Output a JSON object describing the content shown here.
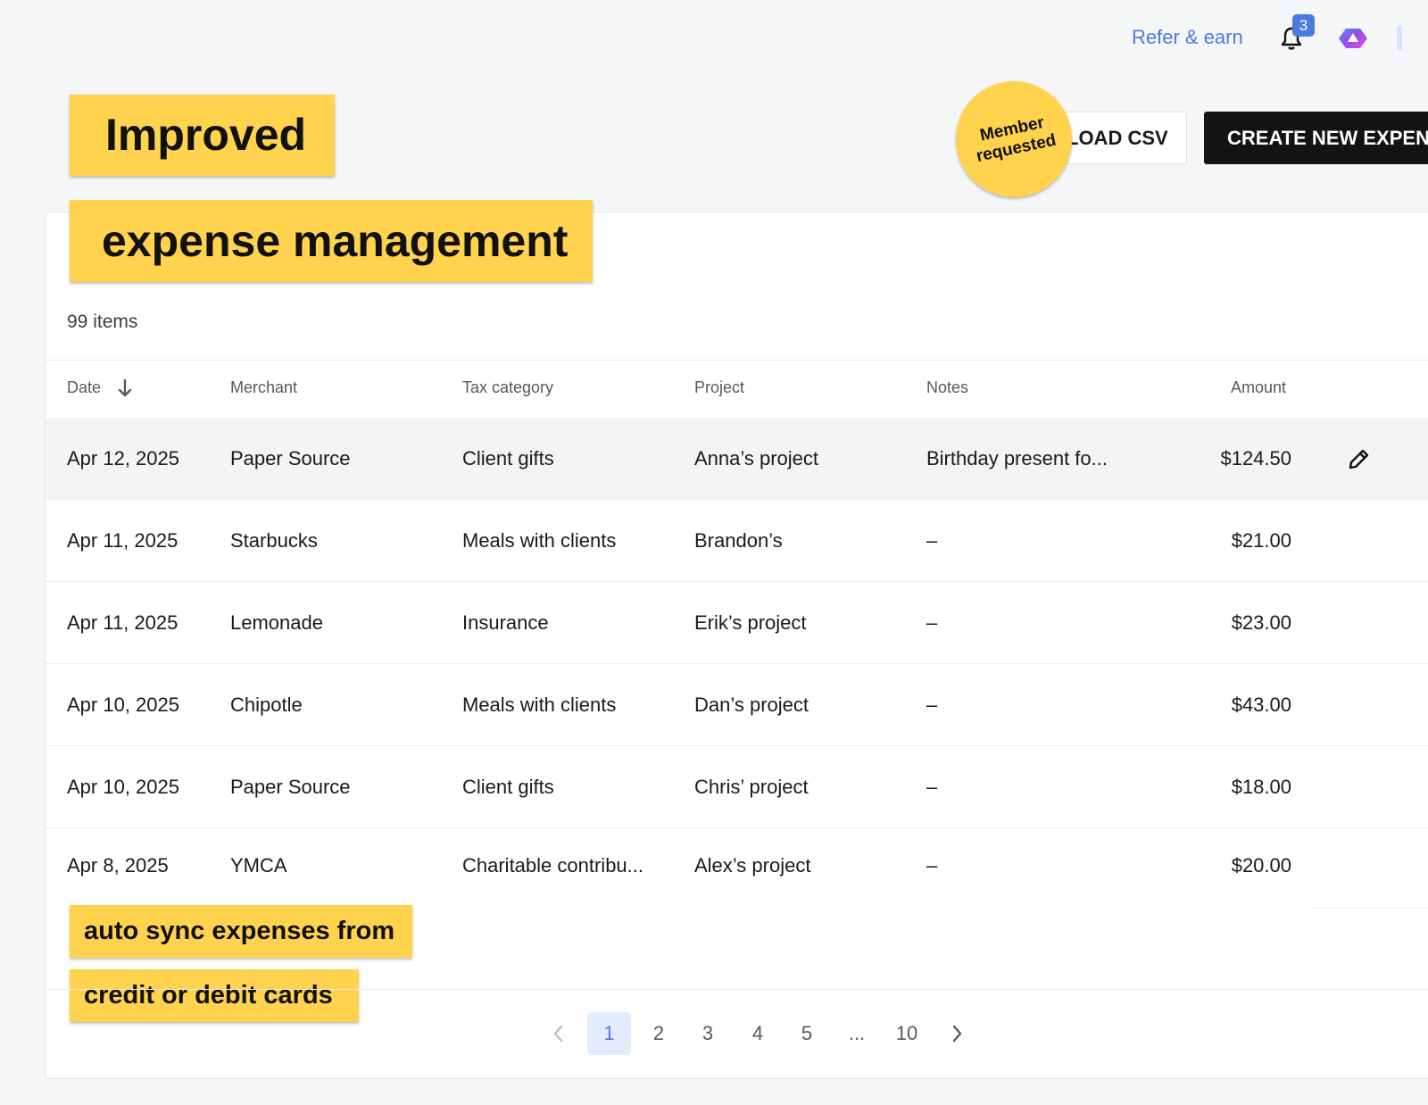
{
  "topbar": {
    "refer_label": "Refer & earn",
    "notification_count": "3"
  },
  "promo": {
    "headline_1": "Improved",
    "headline_2": "expense management",
    "badge_line_1": "Member",
    "badge_line_2": "requested",
    "caption_1": "auto sync expenses from",
    "caption_2": "credit or debit cards"
  },
  "actions": {
    "download_csv_label": "LOAD CSV",
    "create_label": "CREATE NEW EXPENSE"
  },
  "table": {
    "items_count": "99 items",
    "headers": {
      "date": "Date",
      "merchant": "Merchant",
      "tax_category": "Tax category",
      "project": "Project",
      "notes": "Notes",
      "amount": "Amount"
    },
    "rows": [
      {
        "date": "Apr 12, 2025",
        "merchant": "Paper Source",
        "tax_category": "Client gifts",
        "project": "Anna’s project",
        "notes": "Birthday present fo...",
        "amount": "$124.50"
      },
      {
        "date": "Apr 11, 2025",
        "merchant": "Starbucks",
        "tax_category": "Meals with clients",
        "project": "Brandon’s",
        "notes": "–",
        "amount": "$21.00"
      },
      {
        "date": "Apr 11, 2025",
        "merchant": "Lemonade",
        "tax_category": "Insurance",
        "project": "Erik’s project",
        "notes": "–",
        "amount": "$23.00"
      },
      {
        "date": "Apr 10, 2025",
        "merchant": "Chipotle",
        "tax_category": "Meals with clients",
        "project": "Dan’s project",
        "notes": "–",
        "amount": "$43.00"
      },
      {
        "date": "Apr 10, 2025",
        "merchant": "Paper Source",
        "tax_category": "Client gifts",
        "project": "Chris’ project",
        "notes": "–",
        "amount": "$18.00"
      },
      {
        "date": "Apr 8, 2025",
        "merchant": "YMCA",
        "tax_category": "Charitable contribu...",
        "project": "Alex’s project",
        "notes": "–",
        "amount": "$20.00"
      }
    ]
  },
  "pagination": {
    "pages": [
      "1",
      "2",
      "3",
      "4",
      "5",
      "...",
      "10"
    ],
    "current": "1"
  },
  "icons": {
    "bell": "bell-icon",
    "avatar": "avatar-logo",
    "sort": "arrow-down-icon",
    "edit": "pencil-icon",
    "prev": "chevron-left-icon",
    "next": "chevron-right-icon"
  },
  "colors": {
    "accent": "#4a7be0",
    "sticker": "#ffd34e",
    "primary_button": "#131313"
  }
}
